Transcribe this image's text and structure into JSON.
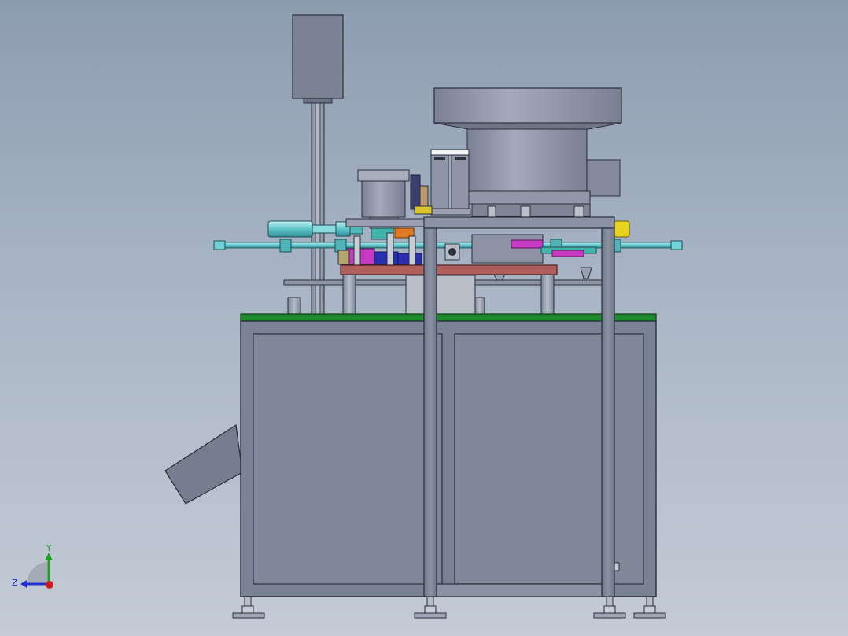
{
  "viewport": {
    "background_top": "#8c9cb0",
    "background_bottom": "#c4cbd6"
  },
  "machine": {
    "frame_color": "#7d8596",
    "table_top_color": "#1f8a2e",
    "plate_color": "#b0605c",
    "cylinder_color": "#6fd2d6",
    "accent_colors": [
      "#c83ac4",
      "#2a2fb0",
      "#e07a22",
      "#d8c62a",
      "#3a8a4a"
    ],
    "bowl_feeder_color": "#8e93a6"
  },
  "triad": {
    "y_label": "Y",
    "z_label": "Z",
    "y_color": "#19a51c",
    "z_color": "#2233cc",
    "x_color": "#d11a1a"
  }
}
